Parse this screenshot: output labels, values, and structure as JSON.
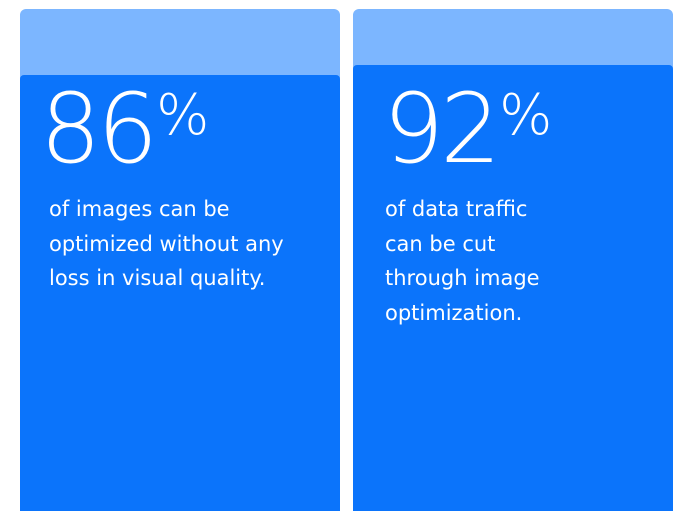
{
  "cards": [
    {
      "number": "86",
      "percent_sign": "%",
      "lines": [
        "of images can be",
        "optimized without any",
        "loss in visual quality."
      ]
    },
    {
      "number": "92",
      "percent_sign": "%",
      "lines": [
        "of data traffic",
        "can be cut",
        "through image",
        "optimization."
      ]
    }
  ],
  "colors": {
    "tab": "#7cb6ff",
    "panel": "#0b74fb",
    "text": "#ffffff"
  }
}
